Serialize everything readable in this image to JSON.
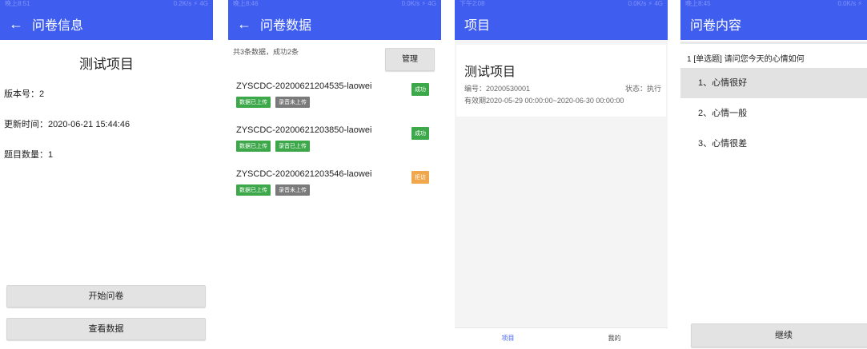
{
  "colors": {
    "primary": "#3f5ef0",
    "success": "#3da84a",
    "warning": "#f0a64a",
    "tag_gray": "#7a7a7a"
  },
  "panel1": {
    "status_left": "晚上8:51",
    "status_right": "0.2K/s ⚡ 4G",
    "back_icon": "arrow-left",
    "title": "问卷信息",
    "project_name": "测试项目",
    "version": "版本号：2",
    "update_time": "更新时间：2020-06-21 15:44:46",
    "question_count": "题目数量：1",
    "start_button": "开始问卷",
    "view_button": "查看数据"
  },
  "panel2": {
    "status_left": "晚上8:46",
    "status_right": "0.0K/s ⚡ 4G",
    "back_icon": "arrow-left",
    "title": "问卷数据",
    "summary": "共3条数据，成功2条",
    "manage_button": "管理",
    "records": [
      {
        "id": "ZYSCDC-20200621204535-laowei",
        "status": "成功",
        "status_color": "#3da84a",
        "tag1": "数据已上传",
        "tag2": "录音未上传"
      },
      {
        "id": "ZYSCDC-20200621203850-laowei",
        "status": "成功",
        "status_color": "#3da84a",
        "tag1": "数据已上传",
        "tag2": "录音已上传"
      },
      {
        "id": "ZYSCDC-20200621203546-laowei",
        "status": "拒访",
        "status_color": "#f0a64a",
        "tag1": "数据已上传",
        "tag2": "录音未上传"
      }
    ]
  },
  "panel3": {
    "status_left": "下午2:08",
    "status_right": "0.0K/s ⚡ 4G",
    "title": "项目",
    "project_name": "测试项目",
    "code": "编号：20200530001",
    "state": "状态：执行",
    "validity": "有效期2020-05-29 00:00:00~2020-06-30 00:00:00",
    "nav_project": "项目",
    "nav_mine": "我的"
  },
  "panel4": {
    "status_left": "晚上8:45",
    "status_right": "0.0K/s ⚡",
    "title": "问卷内容",
    "question": "1 [单选题] 请问您今天的心情如何",
    "options": [
      "1、心情很好",
      "2、心情一般",
      "3、心情很差"
    ],
    "continue_button": "继续"
  }
}
